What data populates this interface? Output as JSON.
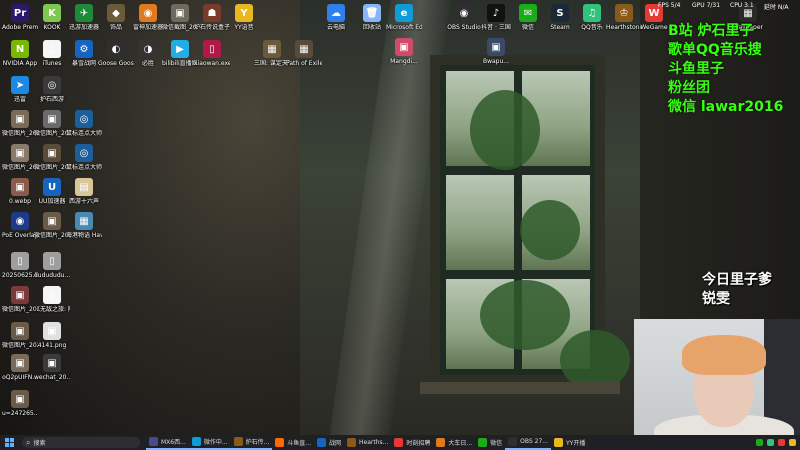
{
  "desktop_icons": [
    {
      "label": "Adobe Premie...",
      "glyph": "Pr",
      "color": "#2a1b6a"
    },
    {
      "label": "KOOK",
      "glyph": "K",
      "color": "#7ec850"
    },
    {
      "label": "迅游加速器",
      "glyph": "✈",
      "color": "#1d8a3a"
    },
    {
      "label": "饰品",
      "glyph": "◆",
      "color": "#6b5b3a"
    },
    {
      "label": "雷神加速器",
      "glyph": "◉",
      "color": "#e07a1f"
    },
    {
      "label": "微信截图_2024071...",
      "glyph": "▣",
      "color": "#6e6a5e"
    },
    {
      "label": "炉石传说盒子",
      "glyph": "☗",
      "color": "#7a3b2a"
    },
    {
      "label": "YY语音",
      "glyph": "Y",
      "color": "#e8b820"
    },
    {
      "label": "NVIDIA App",
      "glyph": "N",
      "color": "#76b900"
    },
    {
      "label": "iTunes",
      "glyph": "♫",
      "color": "#f5f5f5"
    },
    {
      "label": "暴雪战网",
      "glyph": "⚙",
      "color": "#1565c0"
    },
    {
      "label": "Goose Goose Duck",
      "glyph": "◐",
      "color": "#2e2e2e"
    },
    {
      "label": "必胜",
      "glyph": "◑",
      "color": "#333333"
    },
    {
      "label": "bilibili直播姬 捷方式",
      "glyph": "▶",
      "color": "#23ade5"
    },
    {
      "label": "xiaowan.exe - 快捷方式",
      "glyph": "▯",
      "color": "#b01a4a"
    },
    {
      "label": "三国: 谋定天下",
      "glyph": "▦",
      "color": "#6a5a3a"
    },
    {
      "label": "Path of Exile 2",
      "glyph": "▦",
      "color": "#5a4a3a"
    },
    {
      "label": "迅雷",
      "glyph": "➤",
      "color": "#1e88e5"
    },
    {
      "label": "护石西游",
      "glyph": "◎",
      "color": "#3a3a3a"
    },
    {
      "label": "微信图片_2025072...",
      "glyph": "▣",
      "color": "#7a6a5a"
    },
    {
      "label": "微信图片_2025072...",
      "glyph": "▣",
      "color": "#6a6a6a"
    },
    {
      "label": "鼠标连点大师",
      "glyph": "◎",
      "color": "#1b5e9a"
    },
    {
      "label": "微信图片_2025072...",
      "glyph": "▣",
      "color": "#8a7a6a"
    },
    {
      "label": "微信图片_2025072...",
      "glyph": "▣",
      "color": "#5a4a3a"
    },
    {
      "label": "鼠标连点大师",
      "glyph": "◎",
      "color": "#1b5e9a"
    },
    {
      "label": "0.webp",
      "glyph": "▣",
      "color": "#8a5a4a"
    },
    {
      "label": "UU加速器",
      "glyph": "U",
      "color": "#1565c0"
    },
    {
      "label": "西游十六声",
      "glyph": "▤",
      "color": "#d9c79a"
    },
    {
      "label": "PoE Overlay II Standal...",
      "glyph": "◉",
      "color": "#1e3a8a"
    },
    {
      "label": "微信图片_2025073...",
      "glyph": "▣",
      "color": "#6a5a4a"
    },
    {
      "label": "海港物语 Havendock",
      "glyph": "▦",
      "color": "#4a8ab0"
    },
    {
      "label": "20250625.kx",
      "glyph": "▯",
      "color": "#9e9e9e"
    },
    {
      "label": "dudududu...",
      "glyph": "▯",
      "color": "#9e9e9e"
    },
    {
      "label": "微信图片_2025062...",
      "glyph": "▣",
      "color": "#7a3a3a"
    },
    {
      "label": "《无敌之旅: 降临》预先...",
      "glyph": "▯",
      "color": "#f5f5f5"
    },
    {
      "label": "微信图片_2025091...",
      "glyph": "▣",
      "color": "#6a5a4a"
    },
    {
      "label": "4141.png",
      "glyph": "▣",
      "color": "#e0e0e0"
    },
    {
      "label": "oQ2pUIFN...",
      "glyph": "▣",
      "color": "#7a6a5a"
    },
    {
      "label": "wechat_20...",
      "glyph": "▣",
      "color": "#3a3a3a"
    },
    {
      "label": "u=247265...",
      "glyph": "▣",
      "color": "#6a5a4a"
    }
  ],
  "top_icons": [
    {
      "label": "云电脑",
      "glyph": "☁",
      "color": "#2f80ed"
    },
    {
      "label": "回收站",
      "glyph": "🗑",
      "color": "#8ab4f8"
    },
    {
      "label": "Microsoft Edge",
      "glyph": "e",
      "color": "#0c9dd8"
    },
    {
      "label": "Mangdi...",
      "glyph": "▣",
      "color": "#d04a6a"
    },
    {
      "label": "OBS Studio",
      "glyph": "◉",
      "color": "#302e31"
    },
    {
      "label": "抖音 · 三国",
      "glyph": "♪",
      "color": "#111111"
    },
    {
      "label": "Bwapu...",
      "glyph": "▣",
      "color": "#3a4a6a"
    },
    {
      "label": "微信",
      "glyph": "✉",
      "color": "#1aad19"
    },
    {
      "label": "Steam",
      "glyph": "S",
      "color": "#1b2838"
    },
    {
      "label": "QQ音乐",
      "glyph": "♫",
      "color": "#31c27c"
    },
    {
      "label": "Hearthstone",
      "glyph": "♔",
      "color": "#8a5a1a"
    },
    {
      "label": "WeGame",
      "glyph": "W",
      "color": "#e53935"
    },
    {
      "label": "Wallpaper",
      "glyph": "▦",
      "color": "#2a2a2a"
    }
  ],
  "top_text": [
    "FPS 5/4",
    "GPU 7/31",
    "CPU 3.1",
    "延时 N/A"
  ],
  "overlay_lines": [
    "B站  炉石里子",
    "歌单QQ音乐搜",
    "斗鱼里子",
    "粉丝团",
    "微信  lawar2016"
  ],
  "overlay2_lines": [
    "今日里子爹",
    "锐雯"
  ],
  "taskbar": {
    "search_placeholder": "搜索",
    "tasks": [
      {
        "label": "MX6西...",
        "color": "#4a4a8a",
        "active": true
      },
      {
        "label": "微作中...",
        "color": "#0c9dd8",
        "active": true
      },
      {
        "label": "炉石传...",
        "color": "#8a5a1a",
        "active": true
      },
      {
        "label": "斗鱼直...",
        "color": "#ff6a00",
        "active": false
      },
      {
        "label": "战网",
        "color": "#1565c0",
        "active": false
      },
      {
        "label": "Hearths...",
        "color": "#8a5a1a",
        "active": false
      },
      {
        "label": "时刻招聘",
        "color": "#e53935",
        "active": false
      },
      {
        "label": "大车日...",
        "color": "#e07a1f",
        "active": false
      },
      {
        "label": "微信",
        "color": "#1aad19",
        "active": false
      },
      {
        "label": "OBS 27...",
        "color": "#302e31",
        "active": true
      },
      {
        "label": "YY开播",
        "color": "#e8b820",
        "active": false
      }
    ]
  }
}
